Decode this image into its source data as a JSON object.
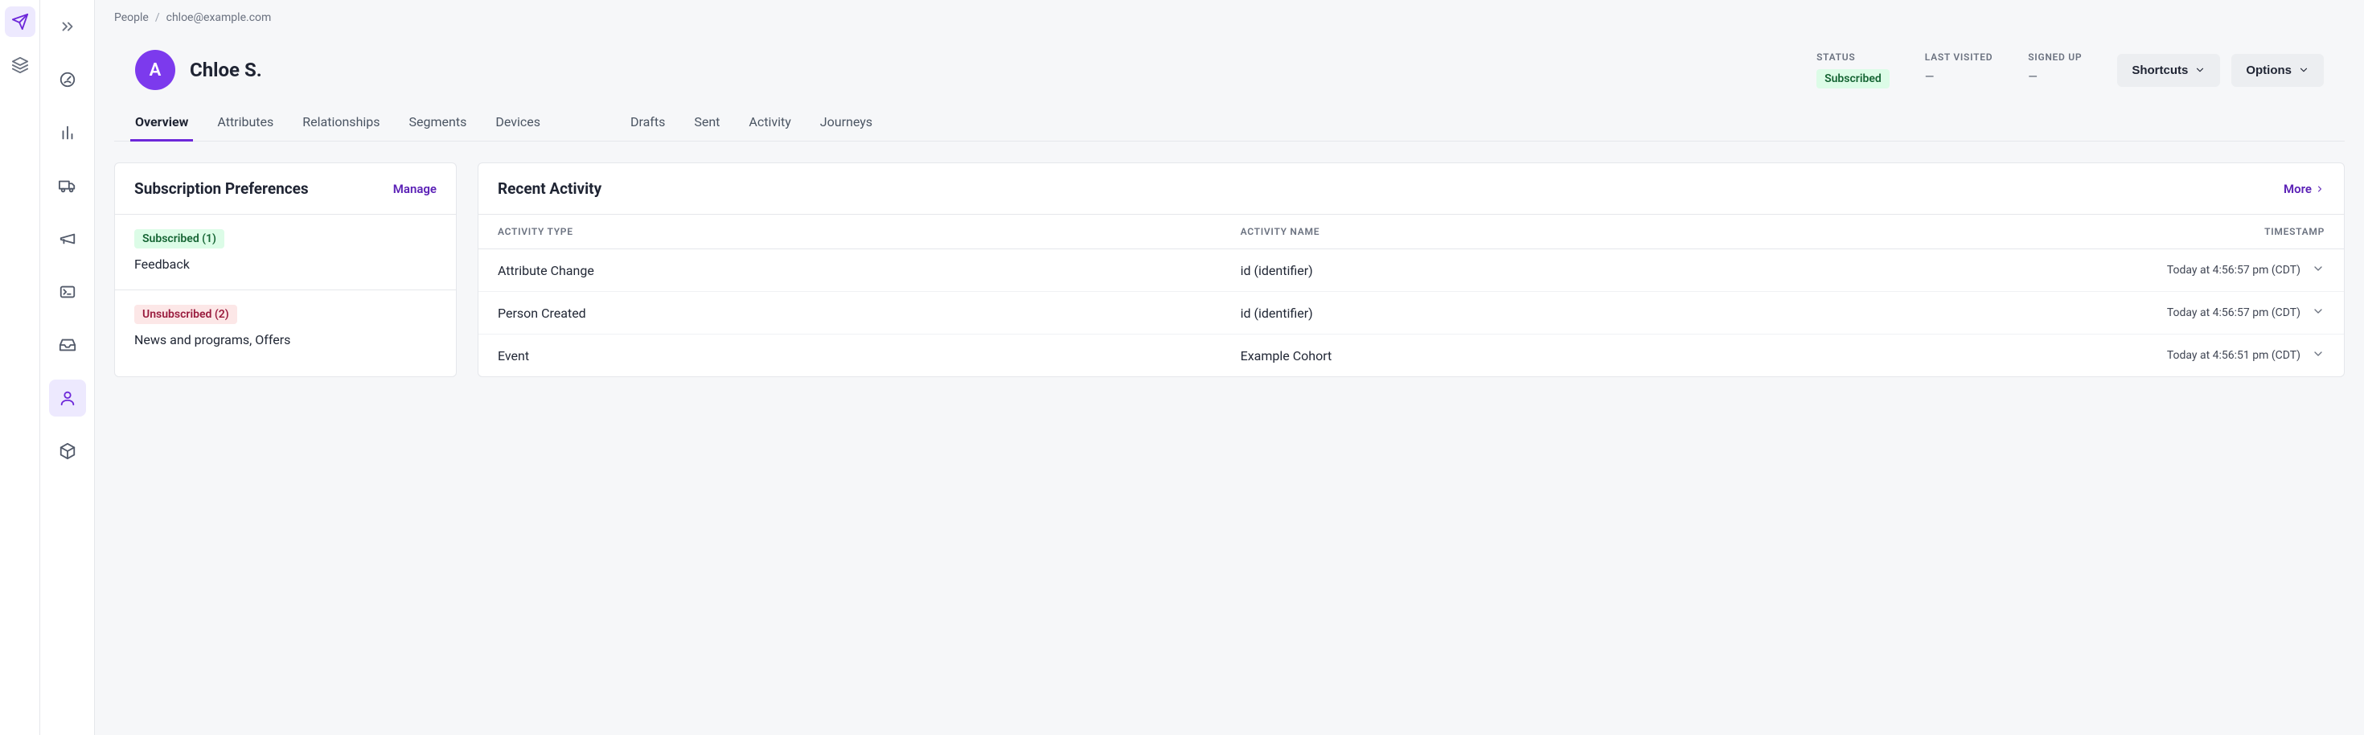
{
  "breadcrumb": {
    "root": "People",
    "current": "chloe@example.com"
  },
  "person": {
    "avatar_initial": "A",
    "name": "Chloe S."
  },
  "meta": {
    "status_label": "STATUS",
    "status_value": "Subscribed",
    "last_visited_label": "LAST VISITED",
    "last_visited_value": "—",
    "signed_up_label": "SIGNED UP",
    "signed_up_value": "—"
  },
  "buttons": {
    "shortcuts": "Shortcuts",
    "options": "Options"
  },
  "tabs": {
    "overview": "Overview",
    "attributes": "Attributes",
    "relationships": "Relationships",
    "segments": "Segments",
    "devices": "Devices",
    "drafts": "Drafts",
    "sent": "Sent",
    "activity": "Activity",
    "journeys": "Journeys"
  },
  "subscription": {
    "title": "Subscription Preferences",
    "manage": "Manage",
    "subscribed_badge": "Subscribed (1)",
    "subscribed_items": "Feedback",
    "unsubscribed_badge": "Unsubscribed (2)",
    "unsubscribed_items": "News and programs, Offers"
  },
  "activity": {
    "title": "Recent Activity",
    "more": "More",
    "col_type": "ACTIVITY TYPE",
    "col_name": "ACTIVITY NAME",
    "col_ts": "TIMESTAMP",
    "rows": [
      {
        "type": "Attribute Change",
        "name": "id (identifier)",
        "ts": "Today at 4:56:57 pm (CDT)"
      },
      {
        "type": "Person Created",
        "name": "id (identifier)",
        "ts": "Today at 4:56:57 pm (CDT)"
      },
      {
        "type": "Event",
        "name": "Example Cohort",
        "ts": "Today at 4:56:51 pm (CDT)"
      }
    ]
  }
}
